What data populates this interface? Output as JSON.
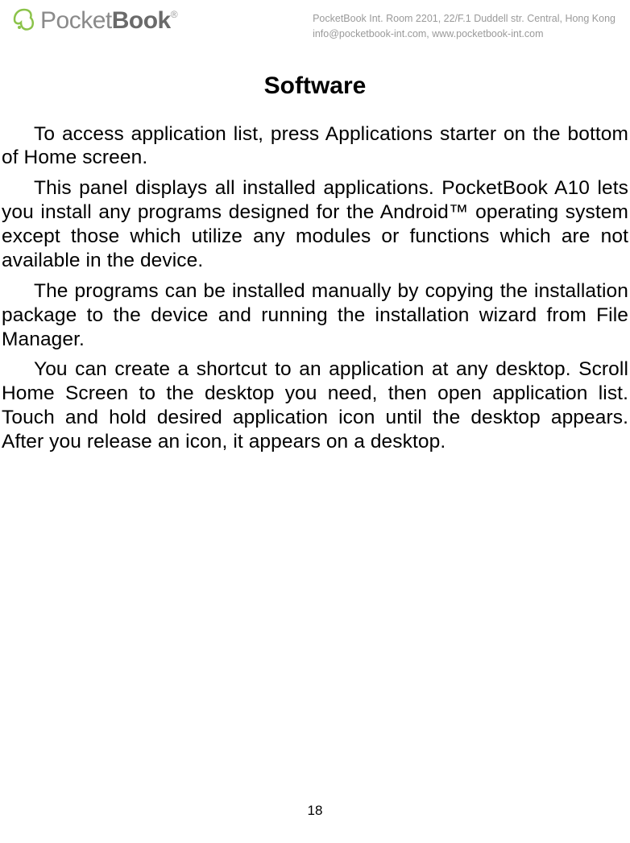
{
  "header": {
    "logo_pocket": "Pocket",
    "logo_book": "Book",
    "logo_reg": "®",
    "address_line1": "PocketBook Int. Room 2201, 22/F.1 Duddell str. Central, Hong Kong",
    "address_line2": "info@pocketbook-int.com, www.pocketbook-int.com"
  },
  "content": {
    "title": "Software",
    "p1": "To access application list, press Applications starter on the bottom of Home screen.",
    "p2": "This panel displays all installed applications. PocketBook A10 lets you install any programs designed for the Android™ operating system except those which utilize any modules or functions which are not available in the device.",
    "p3": "The programs can be installed manually by copying the installation package to the device and running the installation wizard from File Manager.",
    "p4": "You can create a shortcut to an application at any desktop. Scroll Home Screen to the desktop you need, then open application list. Touch and hold desired application icon until the desktop appears. After you release an icon, it appears on a desktop."
  },
  "page_number": "18"
}
